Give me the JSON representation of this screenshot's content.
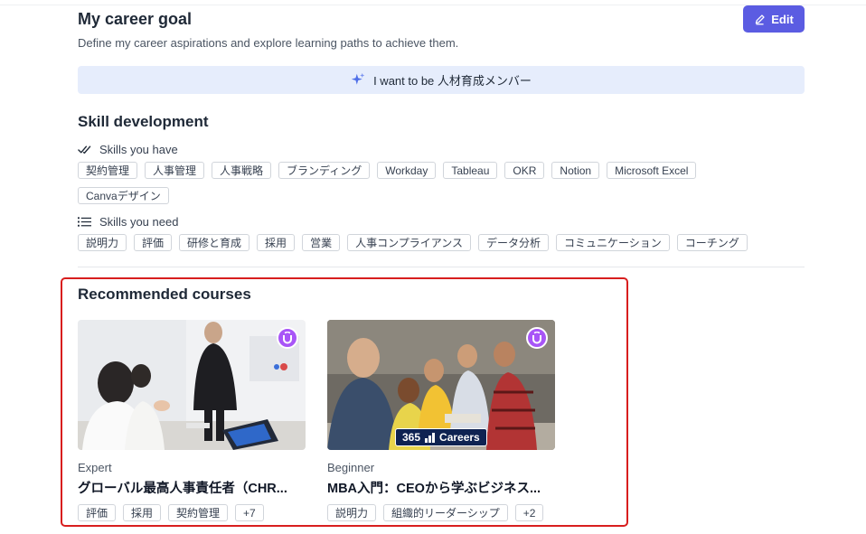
{
  "career_goal": {
    "title": "My career goal",
    "subtitle": "Define my career aspirations and explore learning paths to achieve them.",
    "edit_label": "Edit",
    "goal_text": "I want to be 人材育成メンバー"
  },
  "skills": {
    "title": "Skill development",
    "have_label": "Skills you have",
    "have_row1": [
      "契約管理",
      "人事管理",
      "人事戦略",
      "ブランディング",
      "Workday",
      "Tableau",
      "OKR",
      "Notion",
      "Microsoft Excel"
    ],
    "have_row2": [
      "Canvaデザイン"
    ],
    "need_label": "Skills you need",
    "need": [
      "説明力",
      "評価",
      "研修と育成",
      "採用",
      "営業",
      "人事コンプライアンス",
      "データ分析",
      "コミュニケーション",
      "コーチング"
    ]
  },
  "recommended": {
    "title": "Recommended courses",
    "courses": [
      {
        "level": "Expert",
        "title": "グローバル最高人事責任者（CHR...",
        "tags": [
          "評価",
          "採用",
          "契約管理",
          "+7"
        ]
      },
      {
        "level": "Beginner",
        "title": "MBA入門：CEOから学ぶビジネス...",
        "provider_prefix": "365",
        "provider_name": "Careers",
        "tags": [
          "説明力",
          "組織的リーダーシップ",
          "+2"
        ]
      }
    ]
  },
  "colors": {
    "accent": "#5b5ce2",
    "banner_bg": "#e6edfc",
    "highlight_border": "#d81e1e",
    "badge": "#a855f7"
  }
}
